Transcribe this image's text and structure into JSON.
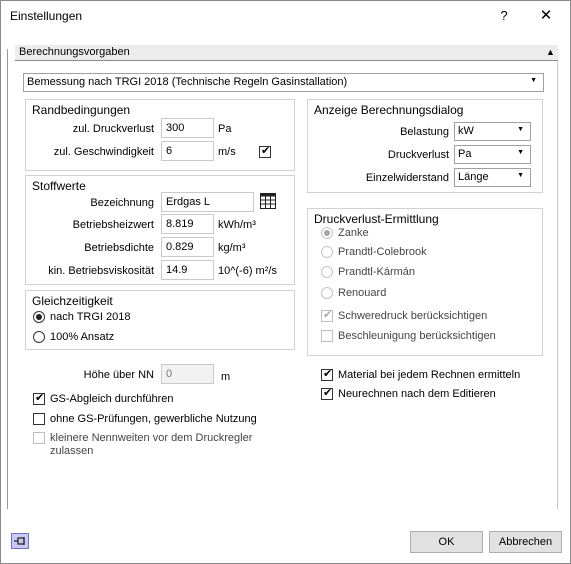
{
  "window": {
    "title": "Einstellungen",
    "help": "?",
    "close": "✕"
  },
  "section": {
    "title": "Berechnungsvorgaben",
    "arrow": "▲"
  },
  "norm_select": "Bemessung nach TRGI 2018 (Technische Regeln Gasinstallation)",
  "randbedingungen": {
    "title": "Randbedingungen",
    "druckverlust_label": "zul. Druckverlust",
    "druckverlust_value": "300",
    "druckverlust_unit": "Pa",
    "geschw_label": "zul. Geschwindigkeit",
    "geschw_value": "6",
    "geschw_unit": "m/s"
  },
  "stoffwerte": {
    "title": "Stoffwerte",
    "bezeichnung_label": "Bezeichnung",
    "bezeichnung_value": "Erdgas L",
    "heizwert_label": "Betriebsheizwert",
    "heizwert_value": "8.819",
    "heizwert_unit": "kWh/m³",
    "dichte_label": "Betriebsdichte",
    "dichte_value": "0.829",
    "dichte_unit": "kg/m³",
    "viskositaet_label": "kin. Betriebsviskosität",
    "viskositaet_value": "14.9",
    "viskositaet_unit": "10^(-6) m²/s"
  },
  "gleichzeitigkeit": {
    "title": "Gleichzeitigkeit",
    "option1": "nach TRGI 2018",
    "option2": "100% Ansatz"
  },
  "hoehe": {
    "label": "Höhe über NN",
    "value": "0",
    "unit": "m"
  },
  "left_checks": {
    "gs_abgleich": "GS-Abgleich durchführen",
    "ohne_gs": "ohne GS-Prüfungen, gewerbliche Nutzung",
    "kleinere_line1": "kleinere Nennweiten vor dem Druckregler",
    "kleinere_line2": "zulassen"
  },
  "anzeige": {
    "title": "Anzeige Berechnungsdialog",
    "belastung_label": "Belastung",
    "belastung_value": "kW",
    "druckverlust_label": "Druckverlust",
    "druckverlust_value": "Pa",
    "einzel_label": "Einzelwiderstand",
    "einzel_value": "Länge"
  },
  "ermittlung": {
    "title": "Druckverlust-Ermittlung",
    "zanke": "Zanke",
    "prandtl_colebrook": "Prandtl-Colebrook",
    "prandtl_karman": "Prandtl-Kármán",
    "renouard": "Renouard",
    "schweredruck": "Schweredruck berücksichtigen",
    "beschleunigung": "Beschleunigung berücksichtigen"
  },
  "right_checks": {
    "material": "Material bei jedem Rechnen ermitteln",
    "neurechnen": "Neurechnen nach dem Editieren"
  },
  "buttons": {
    "ok": "OK",
    "cancel": "Abbrechen"
  },
  "icons": {
    "pin": "pin-icon",
    "table": "table-icon"
  }
}
